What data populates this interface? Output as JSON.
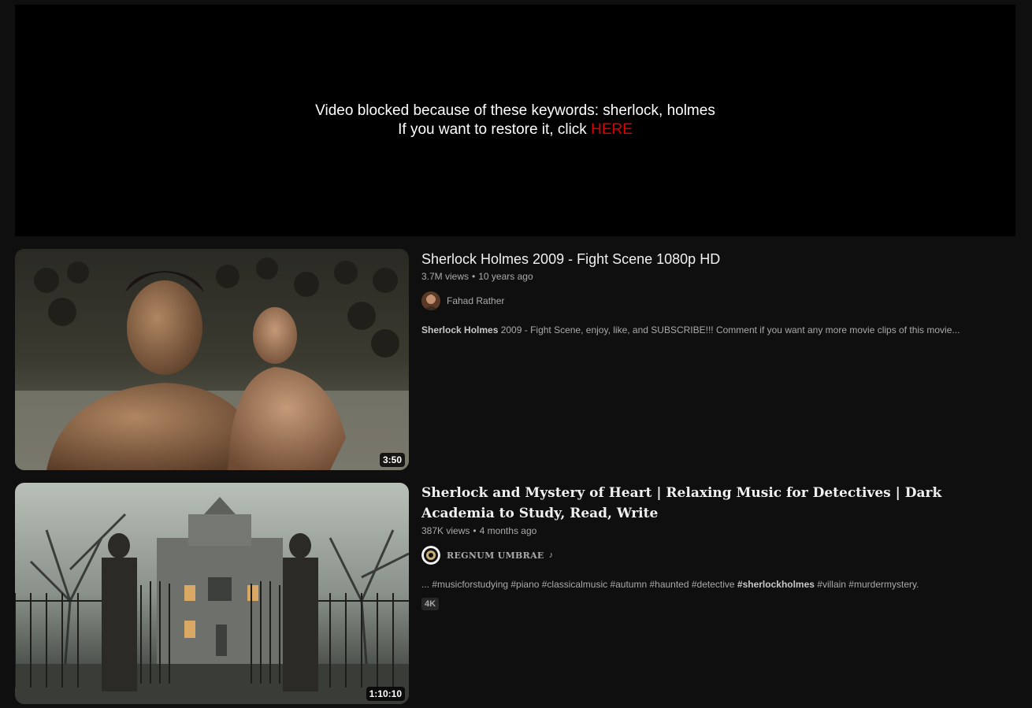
{
  "blocked": {
    "line1": "Video blocked because of these keywords: sherlock, holmes",
    "line2_prefix": "If you want to restore it, click ",
    "link_text": "HERE"
  },
  "results": [
    {
      "title": "Sherlock Holmes 2009 - Fight Scene 1080p HD",
      "views": "3.7M views",
      "age": "10 years ago",
      "channel": "Fahad Rather",
      "description_bold": "Sherlock Holmes",
      "description_rest": " 2009 - Fight Scene, enjoy, like, and SUBSCRIBE!!! Comment if you want any more movie clips of this movie...",
      "duration": "3:50"
    },
    {
      "title": "Sherlock and Mystery of Heart | Relaxing Music for Detectives | Dark Academia to Study, Read, Write",
      "views": "387K views",
      "age": "4 months ago",
      "channel": "REGNUM UMBRAE",
      "channel_icon": "music-note-icon",
      "description_pre": "... #musicforstudying #piano #classicalmusic #autumn #haunted #detective ",
      "description_bold": "#sherlockholmes",
      "description_post": " #villain #murdermystery.",
      "badge": "4K",
      "duration": "1:10:10"
    }
  ],
  "colors": {
    "background": "#0f0f0f",
    "link_red": "#e00000",
    "meta_gray": "#aaaaaa"
  }
}
